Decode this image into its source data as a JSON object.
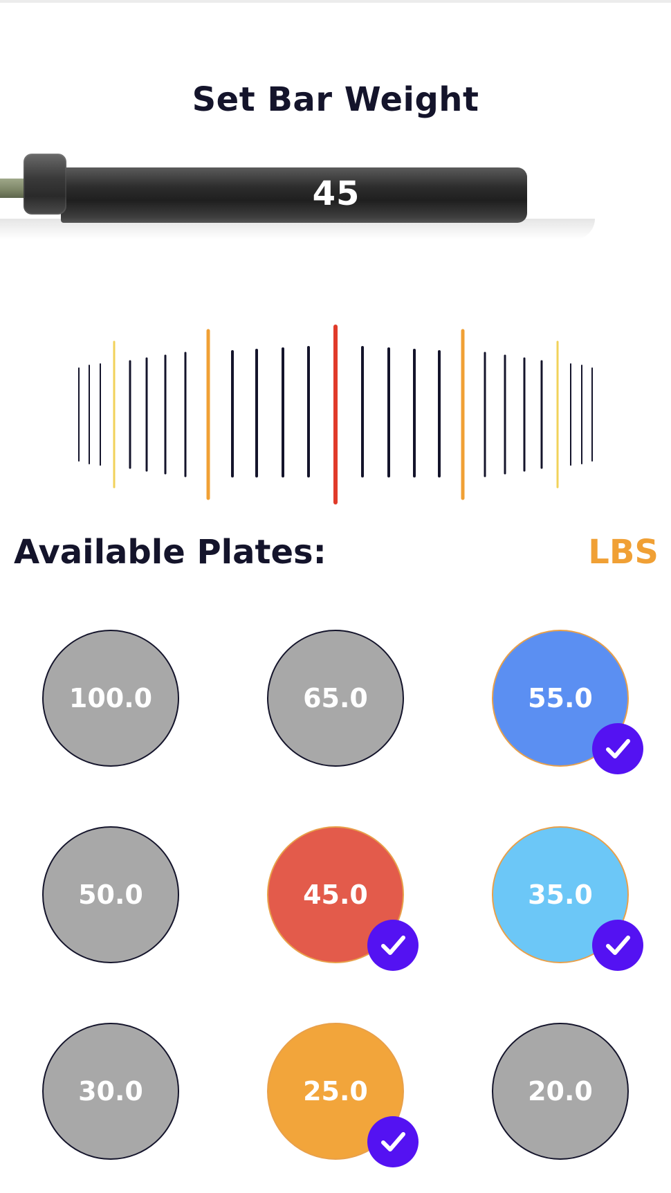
{
  "header": {
    "title": "Set Bar Weight"
  },
  "bar": {
    "weight": "45"
  },
  "ruler": {
    "center_color": "#e03b2a",
    "major_color": "#f0a035",
    "minor_color": "#f2d25a",
    "tick_color": "#14142b"
  },
  "plates_section": {
    "label": "Available Plates:",
    "unit": "LBS"
  },
  "plates": [
    {
      "label": "100.0",
      "color": "#a8a8a8",
      "selected": false
    },
    {
      "label": "65.0",
      "color": "#a8a8a8",
      "selected": false
    },
    {
      "label": "55.0",
      "color": "#5b8ff2",
      "selected": true
    },
    {
      "label": "50.0",
      "color": "#a8a8a8",
      "selected": false
    },
    {
      "label": "45.0",
      "color": "#e35b4b",
      "selected": true
    },
    {
      "label": "35.0",
      "color": "#6cc7f7",
      "selected": true
    },
    {
      "label": "30.0",
      "color": "#a8a8a8",
      "selected": false
    },
    {
      "label": "25.0",
      "color": "#f2a53b",
      "selected": true
    },
    {
      "label": "20.0",
      "color": "#a8a8a8",
      "selected": false
    }
  ],
  "check_color": "#5412f2"
}
